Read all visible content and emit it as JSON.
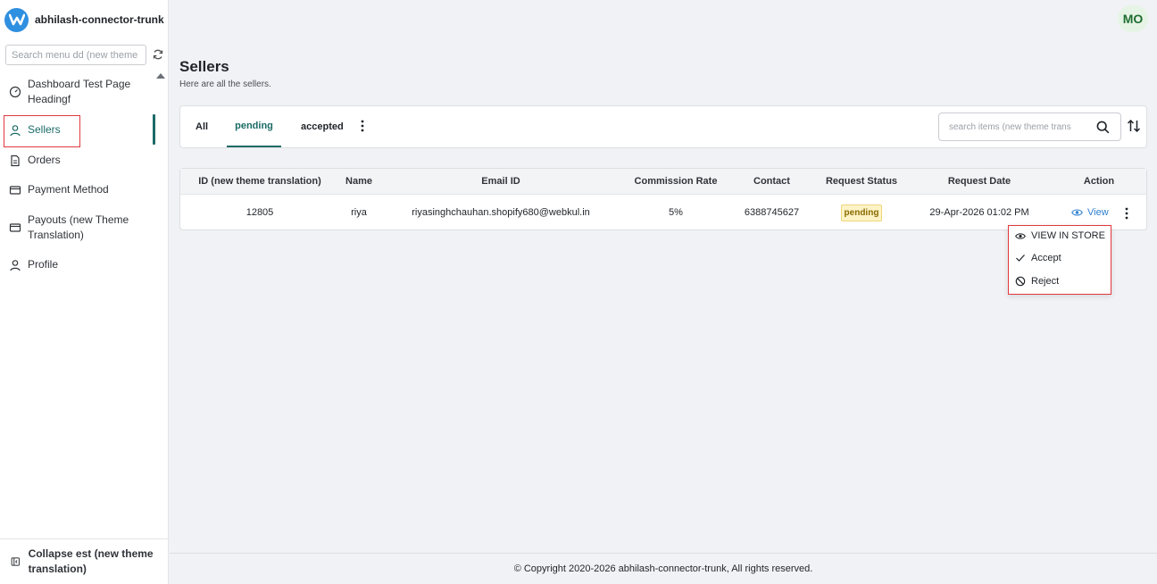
{
  "brand": {
    "name": "abhilash-connector-trunk"
  },
  "sidebar": {
    "search_placeholder": "Search menu dd (new theme tra",
    "items": [
      {
        "label": "Dashboard Test Page Headingf",
        "icon": "dashboard-icon"
      },
      {
        "label": "Sellers",
        "icon": "user-icon",
        "active": true
      },
      {
        "label": "Orders",
        "icon": "document-icon"
      },
      {
        "label": "Payment Method",
        "icon": "card-icon"
      },
      {
        "label": "Payouts (new Theme Translation)",
        "icon": "card-icon"
      },
      {
        "label": "Profile",
        "icon": "user-icon"
      }
    ],
    "collapse_label": "Collapse est (new theme translation)"
  },
  "header": {
    "avatar_initials": "MO"
  },
  "page": {
    "title": "Sellers",
    "subtitle": "Here are all the sellers."
  },
  "tabs": [
    {
      "label": "All"
    },
    {
      "label": "pending",
      "active": true
    },
    {
      "label": "accepted"
    }
  ],
  "search": {
    "placeholder": "search items (new theme trans"
  },
  "table": {
    "columns": [
      "ID (new theme translation)",
      "Name",
      "Email ID",
      "Commission Rate",
      "Contact",
      "Request Status",
      "Request Date",
      "Action"
    ],
    "rows": [
      {
        "id": "12805",
        "name": "riya",
        "email": "riyasinghchauhan.shopify680@webkul.in",
        "commission": "5%",
        "contact": "6388745627",
        "status": "pending",
        "date": "29-Apr-2026 01:02 PM",
        "action": "View"
      }
    ]
  },
  "row_menu": {
    "items": [
      {
        "label": "VIEW IN STORE",
        "icon": "eye-icon"
      },
      {
        "label": "Accept",
        "icon": "check-icon"
      },
      {
        "label": "Reject",
        "icon": "block-icon"
      }
    ]
  },
  "footer": {
    "text": "© Copyright 2020-2026 abhilash-connector-trunk, All rights reserved."
  },
  "colors": {
    "accent": "#1a6b66",
    "brand": "#2f8fe0",
    "highlight": "#e0393e",
    "link": "#2f7fd0"
  }
}
